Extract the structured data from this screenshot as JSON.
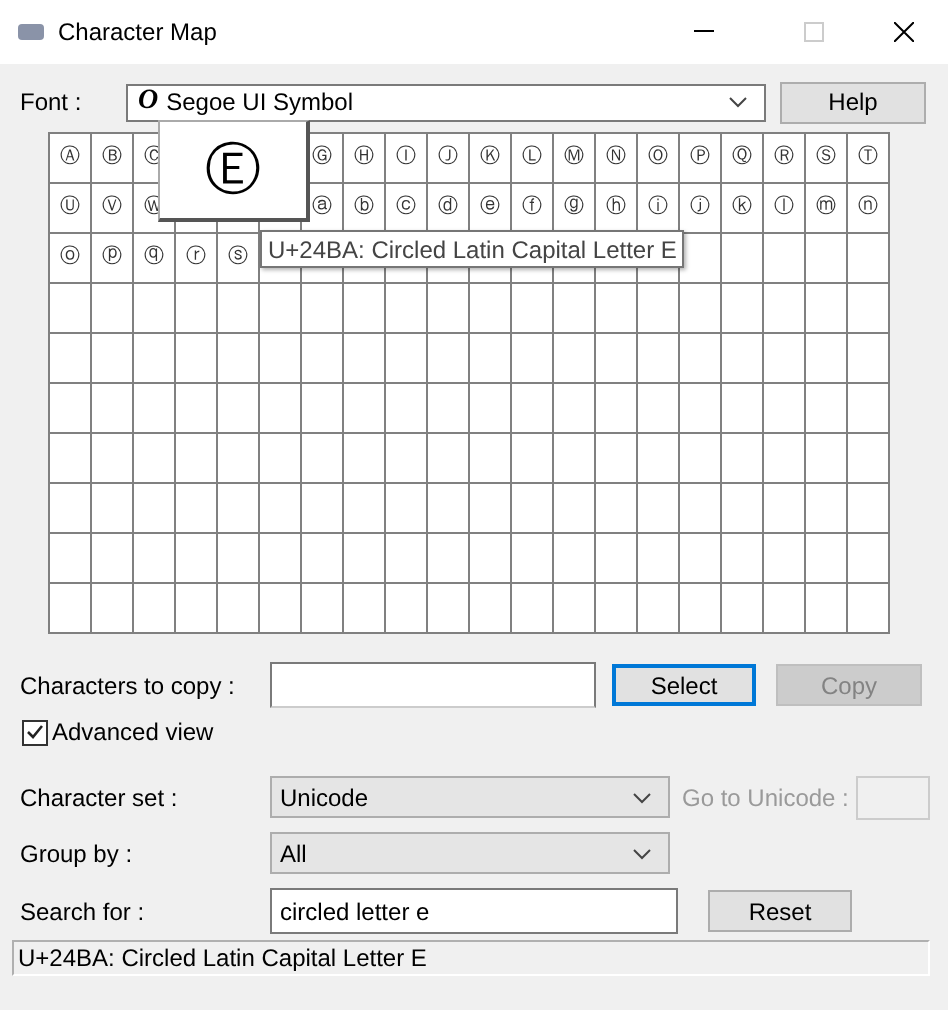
{
  "window": {
    "title": "Character Map"
  },
  "font": {
    "label": "Font :",
    "value": "Segoe UI Symbol",
    "glyph": "O"
  },
  "help_button": "Help",
  "grid": {
    "rows": [
      [
        {
          "char": "Ⓐ"
        },
        {
          "char": "Ⓑ"
        },
        {
          "char": "Ⓒ"
        },
        null,
        null,
        null,
        {
          "char": "Ⓖ"
        },
        {
          "char": "Ⓗ"
        },
        {
          "char": "Ⓘ"
        },
        {
          "char": "Ⓙ"
        },
        {
          "char": "Ⓚ"
        },
        {
          "char": "Ⓛ"
        },
        {
          "char": "Ⓜ"
        },
        {
          "char": "Ⓝ"
        },
        {
          "char": "Ⓞ"
        },
        {
          "char": "Ⓟ"
        },
        {
          "char": "Ⓠ"
        },
        {
          "char": "Ⓡ"
        },
        {
          "char": "Ⓢ"
        },
        {
          "char": "Ⓣ"
        }
      ],
      [
        {
          "char": "Ⓤ"
        },
        {
          "char": "Ⓥ"
        },
        {
          "char": "Ⓦ"
        },
        null,
        null,
        null,
        {
          "char": "ⓐ"
        },
        {
          "char": "ⓑ"
        },
        {
          "char": "ⓒ"
        },
        {
          "char": "ⓓ"
        },
        {
          "char": "ⓔ"
        },
        {
          "char": "ⓕ"
        },
        {
          "char": "ⓖ"
        },
        {
          "char": "ⓗ"
        },
        {
          "char": "ⓘ"
        },
        {
          "char": "ⓙ"
        },
        {
          "char": "ⓚ"
        },
        {
          "char": "ⓛ"
        },
        {
          "char": "ⓜ"
        },
        {
          "char": "ⓝ"
        }
      ],
      [
        {
          "char": "ⓞ"
        },
        {
          "char": "ⓟ"
        },
        {
          "char": "ⓠ"
        },
        {
          "char": "ⓡ"
        },
        {
          "char": "ⓢ"
        },
        null,
        null,
        null,
        null,
        null,
        null,
        null
      ]
    ],
    "magnified": "Ⓔ",
    "tooltip": "U+24BA: Circled Latin Capital Letter E"
  },
  "copy": {
    "label": "Characters to copy :",
    "select_button": "Select",
    "copy_button": {
      "label": "Copy",
      "disabled": true
    }
  },
  "advanced_view": {
    "label": "Advanced view",
    "checked": true
  },
  "character_set": {
    "label": "Character set :",
    "value": "Unicode"
  },
  "goto_unicode": {
    "label": "Go to Unicode :",
    "disabled": true
  },
  "group_by": {
    "label": "Group by :",
    "value": "All"
  },
  "search": {
    "label": "Search for :",
    "value": "circled letter e"
  },
  "reset_button": "Reset",
  "status_bar": "U+24BA: Circled Latin Capital Letter E"
}
